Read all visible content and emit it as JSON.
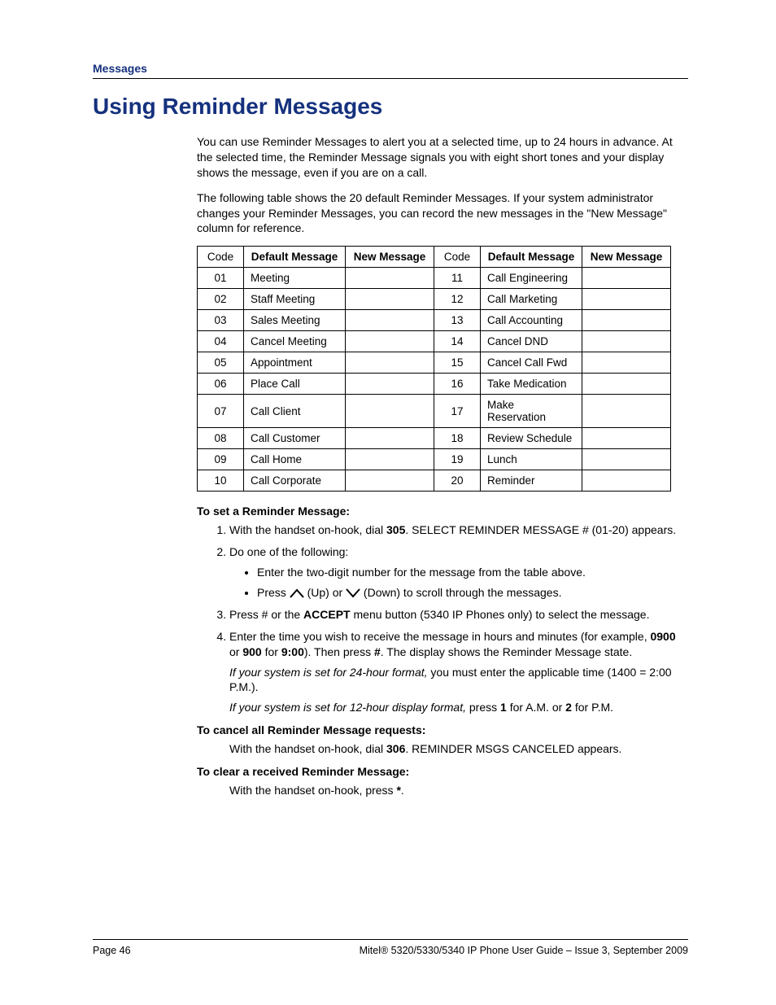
{
  "section_header": "Messages",
  "title": "Using Reminder Messages",
  "para1": "You can use Reminder Messages to alert you at a selected time, up to 24 hours in advance. At the selected time, the Reminder Message signals you with eight short tones and your display shows the message, even if you are on a call.",
  "para2": "The following table shows the 20 default Reminder Messages. If your system administrator changes your Reminder Messages, you can record the new messages in the \"New Message\" column for reference.",
  "headers": {
    "code": "Code",
    "default": "Default Message",
    "new": "New Message"
  },
  "rows_left": [
    {
      "c": "01",
      "m": "Meeting"
    },
    {
      "c": "02",
      "m": "Staff Meeting"
    },
    {
      "c": "03",
      "m": "Sales Meeting"
    },
    {
      "c": "04",
      "m": "Cancel Meeting"
    },
    {
      "c": "05",
      "m": "Appointment"
    },
    {
      "c": "06",
      "m": "Place Call"
    },
    {
      "c": "07",
      "m": "Call Client"
    },
    {
      "c": "08",
      "m": "Call Customer"
    },
    {
      "c": "09",
      "m": "Call Home"
    },
    {
      "c": "10",
      "m": "Call Corporate"
    }
  ],
  "rows_right": [
    {
      "c": "11",
      "m": "Call Engineering"
    },
    {
      "c": "12",
      "m": "Call Marketing"
    },
    {
      "c": "13",
      "m": "Call Accounting"
    },
    {
      "c": "14",
      "m": "Cancel DND"
    },
    {
      "c": "15",
      "m": "Cancel Call Fwd"
    },
    {
      "c": "16",
      "m": "Take Medication"
    },
    {
      "c": "17",
      "m": "Make Reservation"
    },
    {
      "c": "18",
      "m": "Review Schedule"
    },
    {
      "c": "19",
      "m": "Lunch"
    },
    {
      "c": "20",
      "m": "Reminder"
    }
  ],
  "sub1": "To set a Reminder Message:",
  "step1_a": "With the handset on-hook, dial ",
  "step1_b": "305",
  "step1_c": ". SELECT REMINDER MESSAGE # (01-20) appears.",
  "step2": "Do one of the following:",
  "step2_b1": "Enter the two-digit number for the message from the table above.",
  "step2_b2a": "Press ",
  "step2_b2b": " (Up) or ",
  "step2_b2c": " (Down) to scroll through the messages.",
  "step3_a": "Press # or the ",
  "step3_b": "ACCEPT",
  "step3_c": " menu button (5340 IP Phones only) to select the message.",
  "step4_a": "Enter the time you wish to receive the message in hours and minutes (for example, ",
  "step4_b": "0900",
  "step4_c": " or ",
  "step4_d": "900",
  "step4_e": " for ",
  "step4_f": "9:00",
  "step4_g": "). Then press ",
  "step4_h": "#",
  "step4_i": ". The display shows the Reminder Message state.",
  "step4_note1a": "If your system is set for 24-hour format,",
  "step4_note1b": " you must enter the applicable time (1400 = 2:00 P.M.).",
  "step4_note2a": "If your system is set for 12-hour display format,",
  "step4_note2b": " press ",
  "step4_note2c": "1",
  "step4_note2d": " for A.M. or ",
  "step4_note2e": "2",
  "step4_note2f": " for P.M.",
  "sub2": "To cancel all Reminder Message requests:",
  "cancel_a": "With the handset on-hook, dial ",
  "cancel_b": "306",
  "cancel_c": ". REMINDER MSGS CANCELED appears.",
  "sub3": "To clear a received Reminder Message:",
  "clear_a": "With the handset on-hook, press ",
  "clear_b": "*",
  "clear_c": ".",
  "footer_left": "Page 46",
  "footer_right": "Mitel® 5320/5330/5340 IP Phone User Guide – Issue 3, September 2009"
}
